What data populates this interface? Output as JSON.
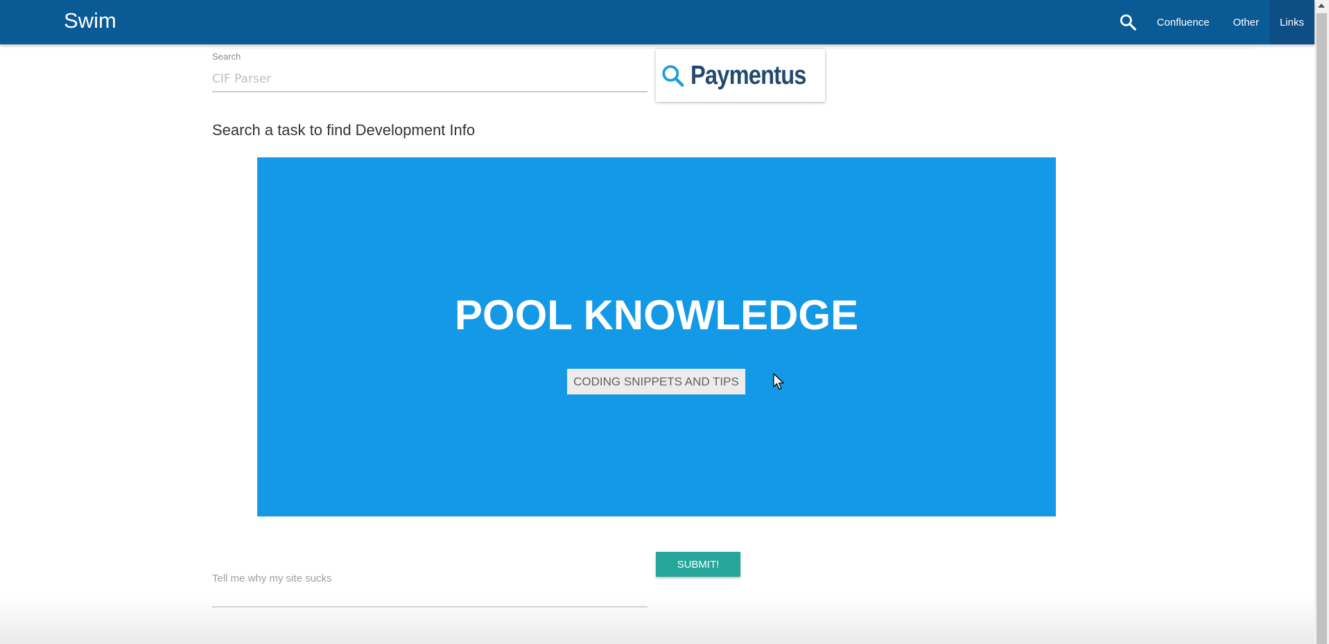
{
  "navbar": {
    "brand": "Swim",
    "links": [
      {
        "label": "Confluence"
      },
      {
        "label": "Other"
      },
      {
        "label": "Links"
      }
    ]
  },
  "search": {
    "label": "Search",
    "placeholder": "CIF Parser"
  },
  "logo": {
    "text": "Paymentus"
  },
  "intro": {
    "text": "Search a task to find Development Info"
  },
  "hero": {
    "title": "POOL KNOWLEDGE",
    "button_label": "CODING SNIPPETS AND TIPS"
  },
  "feedback": {
    "placeholder": "Tell me why my site sucks",
    "submit_label": "SUBMIT!"
  },
  "colors": {
    "navbar": "#0a5a96",
    "hero": "#1399e5",
    "submit": "#26a69a",
    "logo_icon": "#1e9fd8",
    "logo_text": "#234a6e"
  }
}
